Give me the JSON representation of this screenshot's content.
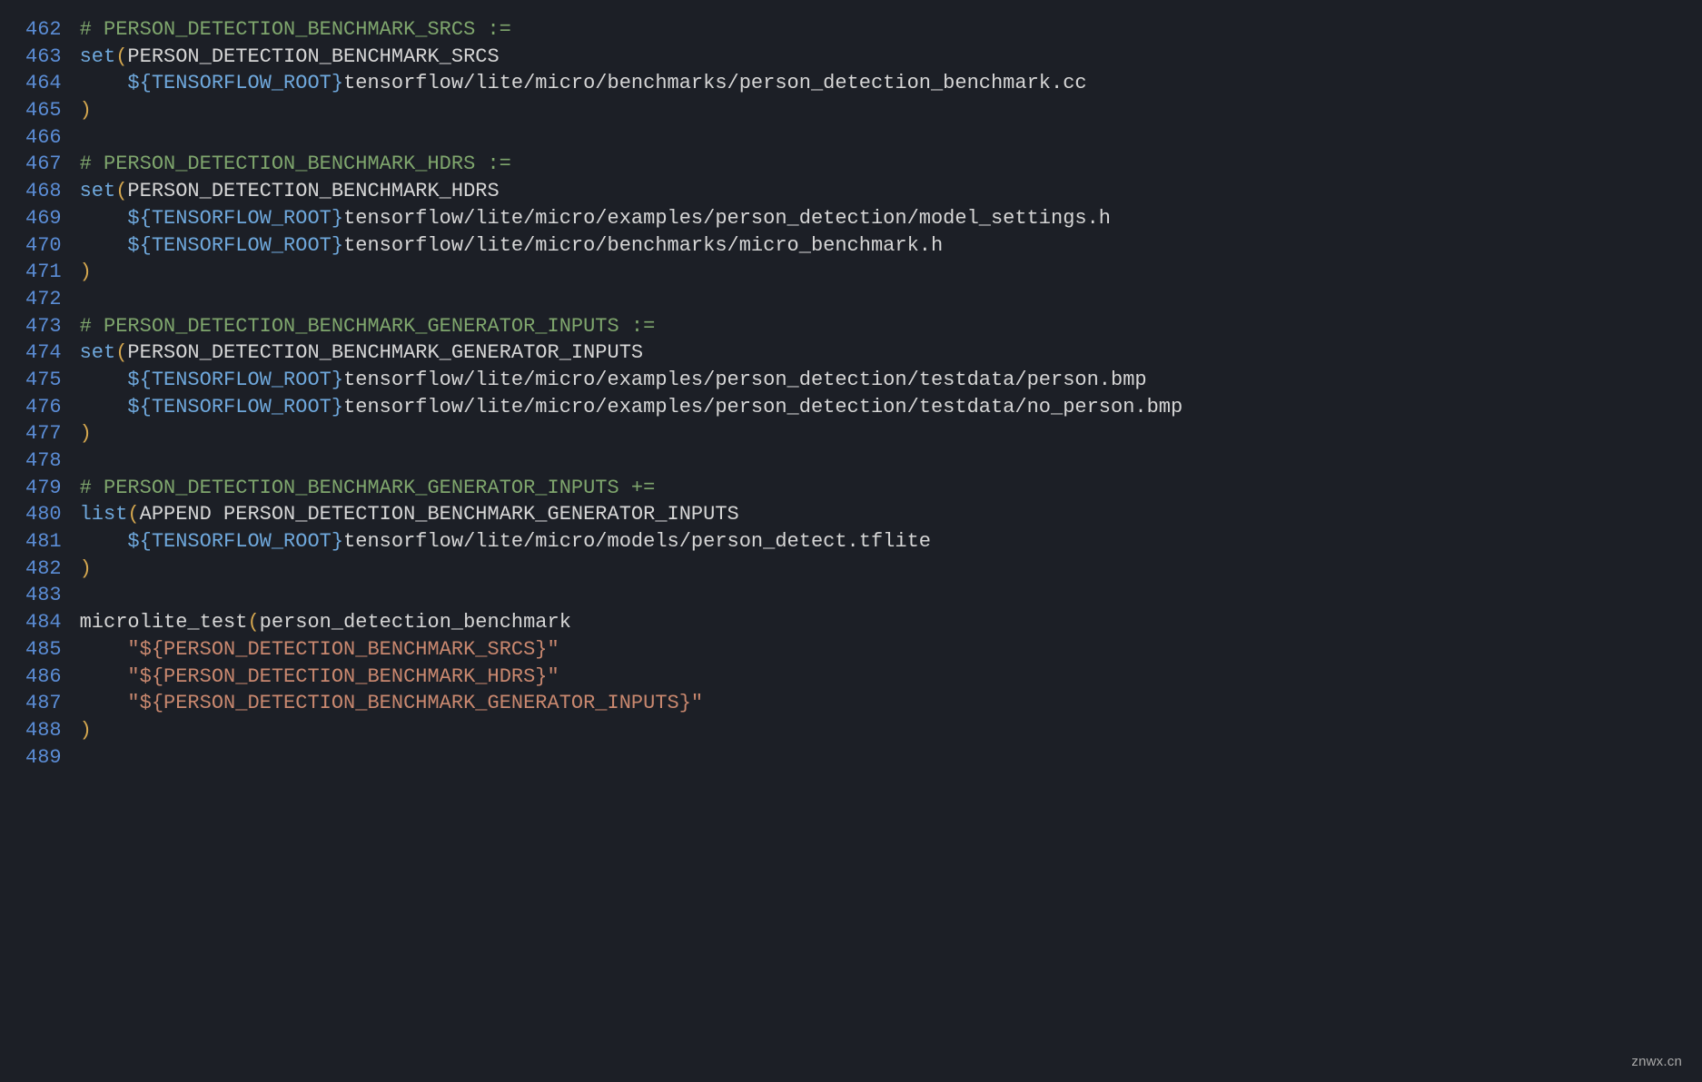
{
  "watermark": "znwx.cn",
  "lines": [
    {
      "n": 462,
      "tokens": [
        {
          "c": "tok-comment",
          "t": "# PERSON_DETECTION_BENCHMARK_SRCS :="
        }
      ]
    },
    {
      "n": 463,
      "tokens": [
        {
          "c": "tok-func",
          "t": "set"
        },
        {
          "c": "tok-paren",
          "t": "("
        },
        {
          "c": "tok-plain",
          "t": "PERSON_DETECTION_BENCHMARK_SRCS"
        }
      ]
    },
    {
      "n": 464,
      "tokens": [
        {
          "c": "tok-plain",
          "t": "    "
        },
        {
          "c": "tok-var",
          "t": "${TENSORFLOW_ROOT}"
        },
        {
          "c": "tok-plain",
          "t": "tensorflow/lite/micro/benchmarks/person_detection_benchmark.cc"
        }
      ]
    },
    {
      "n": 465,
      "tokens": [
        {
          "c": "tok-paren",
          "t": ")"
        }
      ]
    },
    {
      "n": 466,
      "tokens": [
        {
          "c": "tok-plain",
          "t": ""
        }
      ]
    },
    {
      "n": 467,
      "tokens": [
        {
          "c": "tok-comment",
          "t": "# PERSON_DETECTION_BENCHMARK_HDRS :="
        }
      ]
    },
    {
      "n": 468,
      "tokens": [
        {
          "c": "tok-func",
          "t": "set"
        },
        {
          "c": "tok-paren",
          "t": "("
        },
        {
          "c": "tok-plain",
          "t": "PERSON_DETECTION_BENCHMARK_HDRS"
        }
      ]
    },
    {
      "n": 469,
      "tokens": [
        {
          "c": "tok-plain",
          "t": "    "
        },
        {
          "c": "tok-var",
          "t": "${TENSORFLOW_ROOT}"
        },
        {
          "c": "tok-plain",
          "t": "tensorflow/lite/micro/examples/person_detection/model_settings.h"
        }
      ]
    },
    {
      "n": 470,
      "tokens": [
        {
          "c": "tok-plain",
          "t": "    "
        },
        {
          "c": "tok-var",
          "t": "${TENSORFLOW_ROOT}"
        },
        {
          "c": "tok-plain",
          "t": "tensorflow/lite/micro/benchmarks/micro_benchmark.h"
        }
      ]
    },
    {
      "n": 471,
      "tokens": [
        {
          "c": "tok-paren",
          "t": ")"
        }
      ]
    },
    {
      "n": 472,
      "tokens": [
        {
          "c": "tok-plain",
          "t": ""
        }
      ]
    },
    {
      "n": 473,
      "tokens": [
        {
          "c": "tok-comment",
          "t": "# PERSON_DETECTION_BENCHMARK_GENERATOR_INPUTS :="
        }
      ]
    },
    {
      "n": 474,
      "tokens": [
        {
          "c": "tok-func",
          "t": "set"
        },
        {
          "c": "tok-paren",
          "t": "("
        },
        {
          "c": "tok-plain",
          "t": "PERSON_DETECTION_BENCHMARK_GENERATOR_INPUTS"
        }
      ]
    },
    {
      "n": 475,
      "tokens": [
        {
          "c": "tok-plain",
          "t": "    "
        },
        {
          "c": "tok-var",
          "t": "${TENSORFLOW_ROOT}"
        },
        {
          "c": "tok-plain",
          "t": "tensorflow/lite/micro/examples/person_detection/testdata/person.bmp"
        }
      ]
    },
    {
      "n": 476,
      "tokens": [
        {
          "c": "tok-plain",
          "t": "    "
        },
        {
          "c": "tok-var",
          "t": "${TENSORFLOW_ROOT}"
        },
        {
          "c": "tok-plain",
          "t": "tensorflow/lite/micro/examples/person_detection/testdata/no_person.bmp"
        }
      ]
    },
    {
      "n": 477,
      "tokens": [
        {
          "c": "tok-paren",
          "t": ")"
        }
      ]
    },
    {
      "n": 478,
      "tokens": [
        {
          "c": "tok-plain",
          "t": ""
        }
      ]
    },
    {
      "n": 479,
      "tokens": [
        {
          "c": "tok-comment",
          "t": "# PERSON_DETECTION_BENCHMARK_GENERATOR_INPUTS +="
        }
      ]
    },
    {
      "n": 480,
      "tokens": [
        {
          "c": "tok-func",
          "t": "list"
        },
        {
          "c": "tok-paren",
          "t": "("
        },
        {
          "c": "tok-plain",
          "t": "APPEND PERSON_DETECTION_BENCHMARK_GENERATOR_INPUTS"
        }
      ]
    },
    {
      "n": 481,
      "tokens": [
        {
          "c": "tok-plain",
          "t": "    "
        },
        {
          "c": "tok-var",
          "t": "${TENSORFLOW_ROOT}"
        },
        {
          "c": "tok-plain",
          "t": "tensorflow/lite/micro/models/person_detect.tflite"
        }
      ]
    },
    {
      "n": 482,
      "tokens": [
        {
          "c": "tok-paren",
          "t": ")"
        }
      ]
    },
    {
      "n": 483,
      "tokens": [
        {
          "c": "tok-plain",
          "t": ""
        }
      ]
    },
    {
      "n": 484,
      "tokens": [
        {
          "c": "tok-plain",
          "t": "microlite_test"
        },
        {
          "c": "tok-paren",
          "t": "("
        },
        {
          "c": "tok-plain",
          "t": "person_detection_benchmark"
        }
      ]
    },
    {
      "n": 485,
      "tokens": [
        {
          "c": "tok-plain",
          "t": "    "
        },
        {
          "c": "tok-string",
          "t": "\"${PERSON_DETECTION_BENCHMARK_SRCS}\""
        }
      ]
    },
    {
      "n": 486,
      "tokens": [
        {
          "c": "tok-plain",
          "t": "    "
        },
        {
          "c": "tok-string",
          "t": "\"${PERSON_DETECTION_BENCHMARK_HDRS}\""
        }
      ]
    },
    {
      "n": 487,
      "tokens": [
        {
          "c": "tok-plain",
          "t": "    "
        },
        {
          "c": "tok-string",
          "t": "\"${PERSON_DETECTION_BENCHMARK_GENERATOR_INPUTS}\""
        }
      ]
    },
    {
      "n": 488,
      "tokens": [
        {
          "c": "tok-paren",
          "t": ")"
        }
      ]
    },
    {
      "n": 489,
      "tokens": [
        {
          "c": "tok-plain",
          "t": ""
        }
      ]
    }
  ]
}
